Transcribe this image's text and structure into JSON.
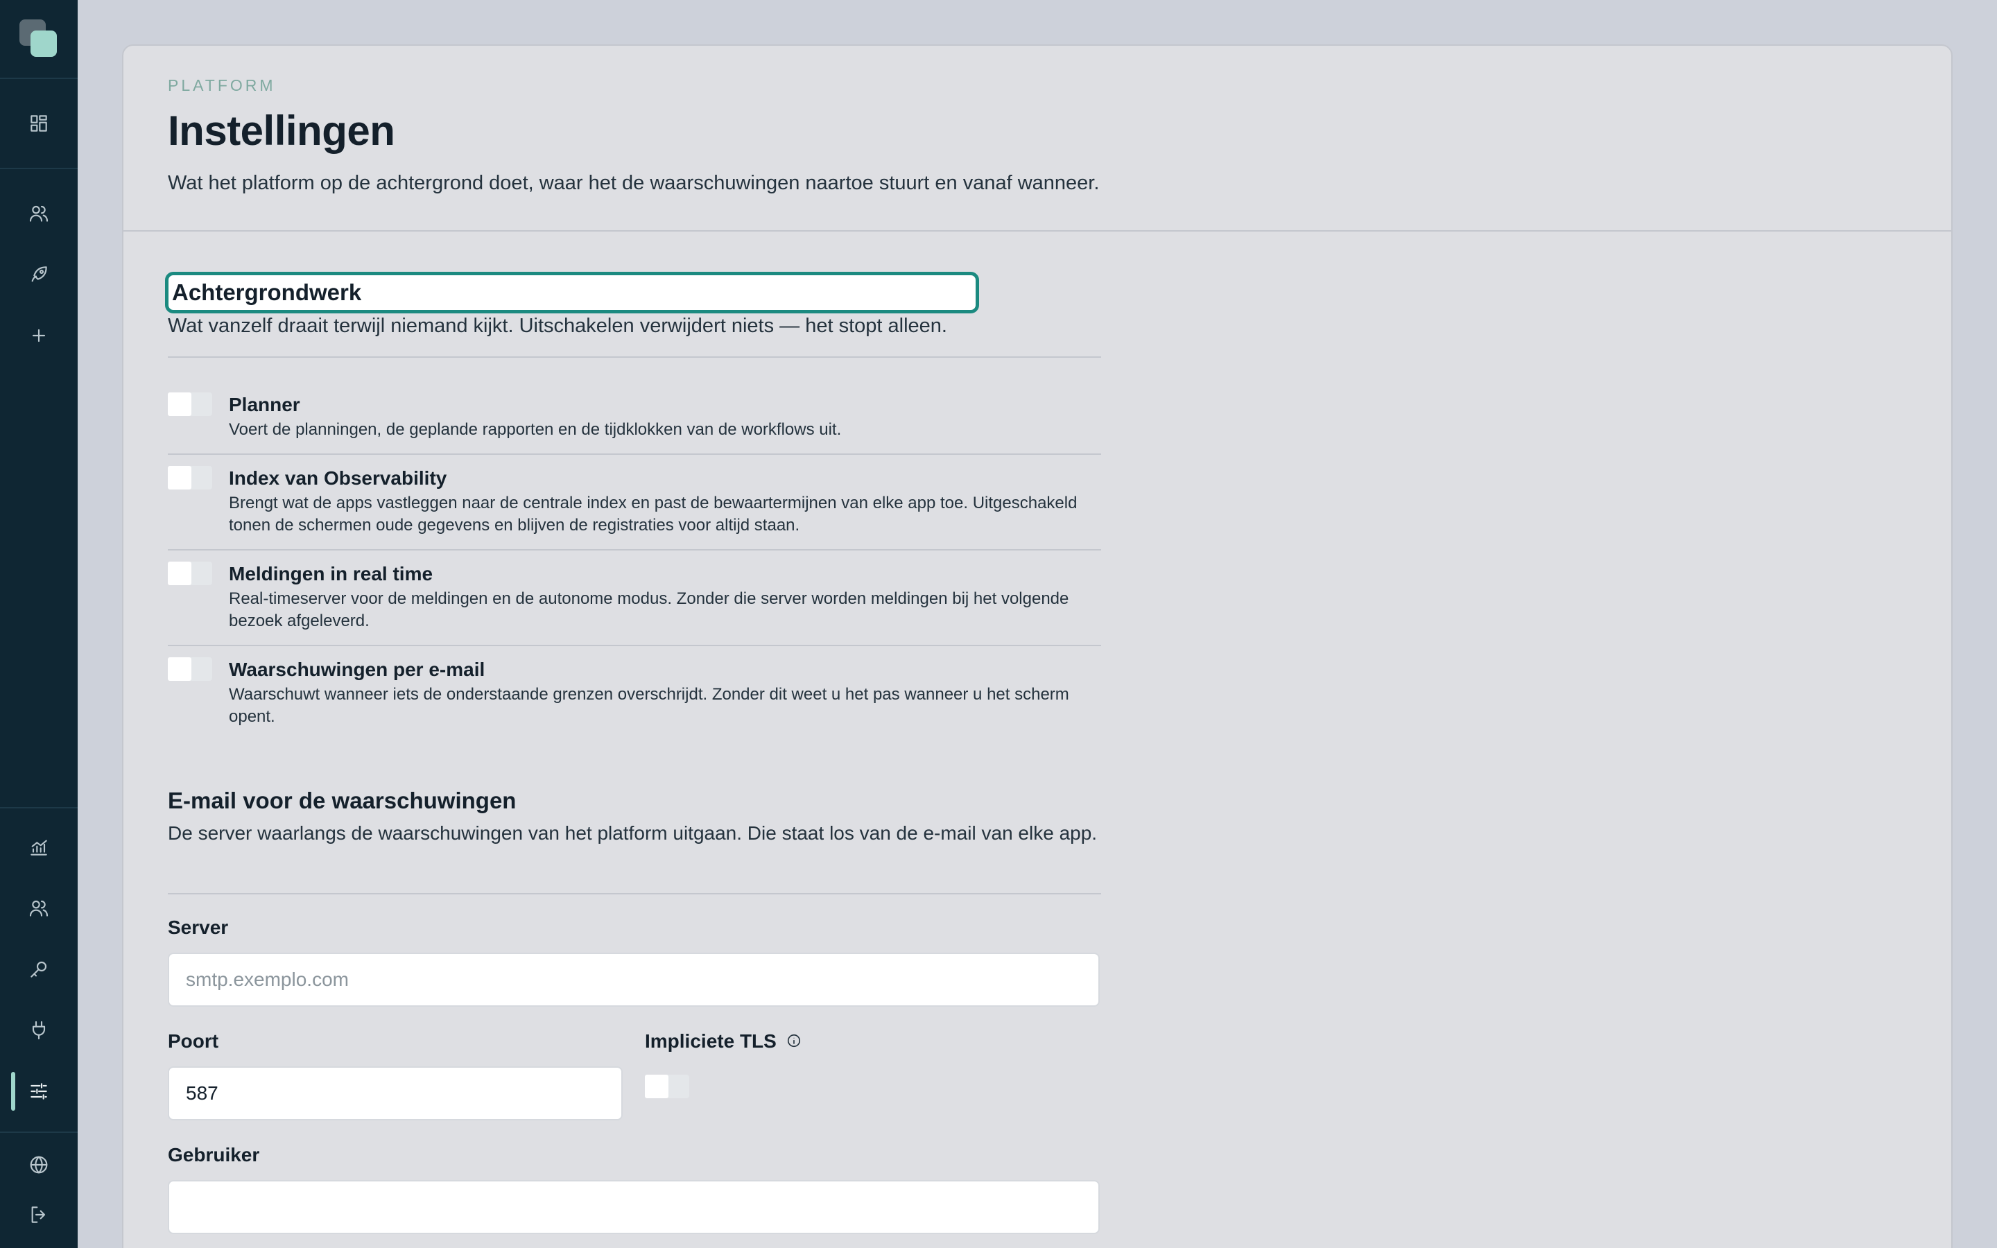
{
  "sidebar": {
    "top_icons": [
      "dashboard-icon",
      "users-icon",
      "rocket-icon",
      "plus-icon"
    ],
    "bottom_icons": [
      "analytics-icon",
      "team-icon",
      "key-icon",
      "plug-icon",
      "settings-sliders-icon"
    ],
    "footer_icons": [
      "globe-icon",
      "logout-icon"
    ],
    "active": "settings-sliders-icon",
    "accent_color": "#9fd6cb"
  },
  "header": {
    "eyebrow": "PLATFORM",
    "title": "Instellingen",
    "subtitle": "Wat het platform op de achtergrond doet, waar het de waarschuwingen naartoe stuurt en vanaf wanneer."
  },
  "background_section": {
    "title": "Achtergrondwerk",
    "subtitle": "Wat vanzelf draait terwijl niemand kijkt. Uitschakelen verwijdert niets — het stopt alleen.",
    "items": [
      {
        "title": "Planner",
        "description": "Voert de planningen, de geplande rapporten en de tijdklokken van de workflows uit.",
        "enabled": false
      },
      {
        "title": "Index van Observability",
        "description": "Brengt wat de apps vastleggen naar de centrale index en past de bewaartermijnen van elke app toe. Uitgeschakeld tonen de schermen oude gegevens en blijven de registraties voor altijd staan.",
        "enabled": false
      },
      {
        "title": "Meldingen in real time",
        "description": "Real-timeserver voor de meldingen en de autonome modus. Zonder die server worden meldingen bij het volgende bezoek afgeleverd.",
        "enabled": false
      },
      {
        "title": "Waarschuwingen per e-mail",
        "description": "Waarschuwt wanneer iets de onderstaande grenzen overschrijdt. Zonder dit weet u het pas wanneer u het scherm opent.",
        "enabled": false
      }
    ]
  },
  "email_section": {
    "title": "E-mail voor de waarschuwingen",
    "subtitle": "De server waarlangs de waarschuwingen van het platform uitgaan. Die staat los van de e-mail van elke app.",
    "server": {
      "label": "Server",
      "placeholder": "smtp.exemplo.com",
      "value": ""
    },
    "port": {
      "label": "Poort",
      "value": "587"
    },
    "implicit_tls": {
      "label": "Impliciete TLS",
      "enabled": false
    },
    "user": {
      "label": "Gebruiker",
      "value": ""
    }
  },
  "colors": {
    "focus_ring": "#1b8a80",
    "sidebar_bg": "#0f2633",
    "eyebrow": "#7fa9a0"
  }
}
